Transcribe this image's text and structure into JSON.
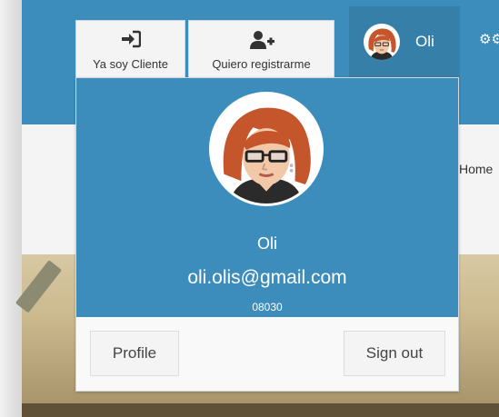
{
  "navbar": {
    "login_button": {
      "label": "Ya soy Cliente",
      "icon": "sign-in-icon"
    },
    "register_button": {
      "label": "Quiero registrarme",
      "icon": "user-plus-icon"
    },
    "user_menu": {
      "name": "Oli",
      "avatar": "female-avatar"
    },
    "settings_icon": "gears-icon"
  },
  "breadcrumb": {
    "home": "Home"
  },
  "dropdown": {
    "name": "Oli",
    "email": "oli.olis@gmail.com",
    "postal_code": "08030",
    "profile_button": "Profile",
    "signout_button": "Sign out"
  },
  "colors": {
    "primary": "#3c8dbc",
    "primary_dark": "#367fa9",
    "button_bg": "#f4f4f4",
    "footer_bg": "#f9f9f9"
  }
}
